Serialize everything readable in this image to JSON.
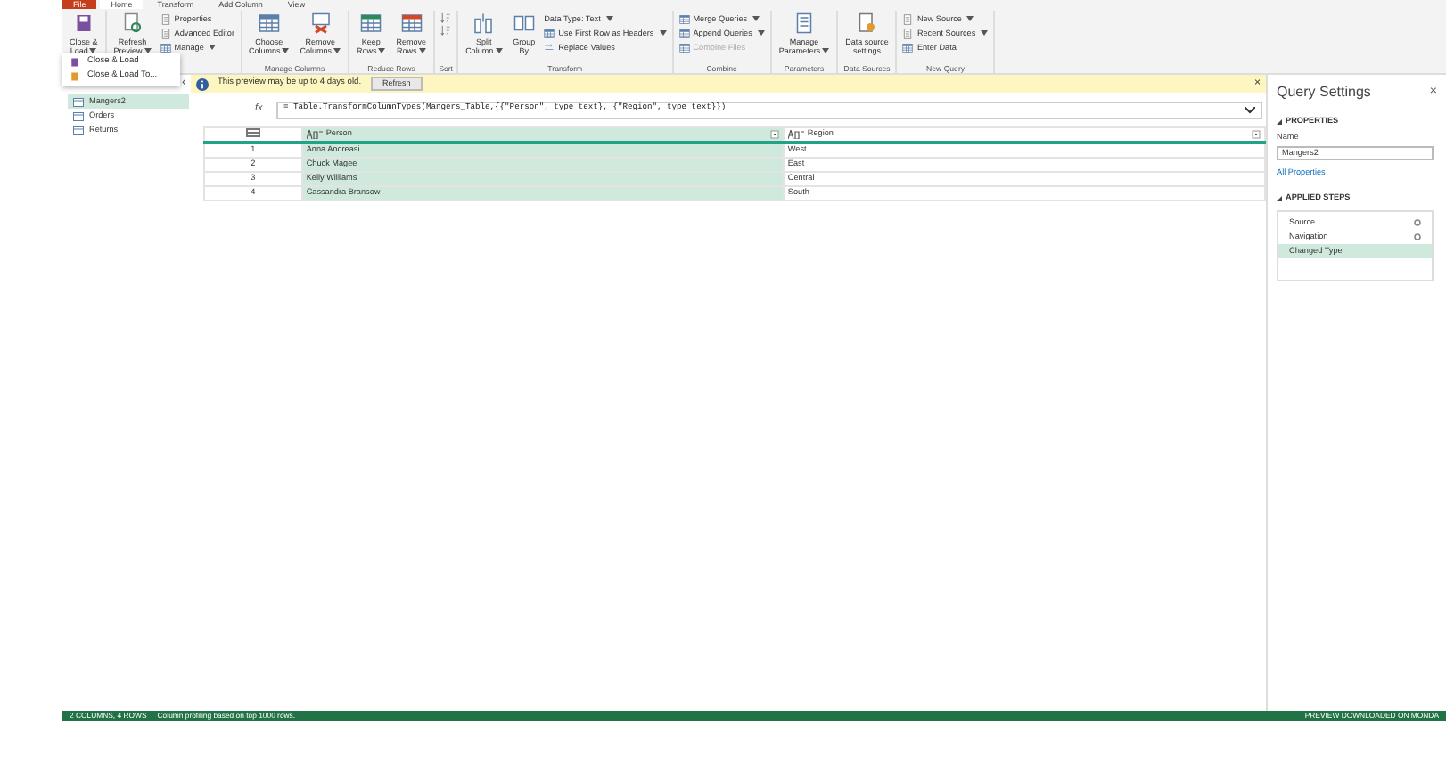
{
  "ribbon_tabs": [
    {
      "label": "File",
      "selected": false,
      "kind": "file"
    },
    {
      "label": "Home",
      "selected": true,
      "kind": "tab"
    },
    {
      "label": "Transform",
      "selected": false,
      "kind": "tab"
    },
    {
      "label": "Add Column",
      "selected": false,
      "kind": "tab"
    },
    {
      "label": "View",
      "selected": false,
      "kind": "tab"
    }
  ],
  "ribbon_groups": [
    {
      "items": [
        {
          "kind": "large",
          "lines": [
            "Close &",
            "Load"
          ],
          "dropdown": true
        }
      ]
    },
    {
      "items": [
        {
          "kind": "large",
          "lines": [
            "Refresh",
            "Preview"
          ],
          "dropdown": true
        },
        {
          "kind": "stack",
          "entries": [
            {
              "label": "Properties",
              "dropdown": false,
              "disabled": false
            },
            {
              "label": "Advanced Editor",
              "dropdown": false,
              "disabled": false
            },
            {
              "label": "Manage",
              "dropdown": true,
              "disabled": false
            }
          ]
        }
      ]
    },
    {
      "label": "Manage Columns",
      "items": [
        {
          "kind": "large",
          "lines": [
            "Choose",
            "Columns"
          ],
          "dropdown": true
        },
        {
          "kind": "large",
          "lines": [
            "Remove",
            "Columns"
          ],
          "dropdown": true
        }
      ]
    },
    {
      "label": "Reduce Rows",
      "items": [
        {
          "kind": "large",
          "lines": [
            "Keep",
            "Rows"
          ],
          "dropdown": true
        },
        {
          "kind": "large",
          "lines": [
            "Remove",
            "Rows"
          ],
          "dropdown": true
        }
      ]
    },
    {
      "label": "Sort",
      "items": [
        {
          "kind": "sort"
        }
      ]
    },
    {
      "label": "Transform",
      "items": [
        {
          "kind": "large",
          "lines": [
            "Split",
            "Column"
          ],
          "dropdown": true
        },
        {
          "kind": "large",
          "lines": [
            "Group",
            "By"
          ],
          "dropdown": false
        },
        {
          "kind": "stack",
          "entries": [
            {
              "label": "Data Type: Text",
              "dropdown": true,
              "disabled": false
            },
            {
              "label": "Use First Row as Headers",
              "dropdown": true,
              "disabled": false
            },
            {
              "label": "Replace Values",
              "dropdown": false,
              "disabled": false
            }
          ]
        }
      ]
    },
    {
      "label": "Combine",
      "items": [
        {
          "kind": "stack",
          "entries": [
            {
              "label": "Merge Queries",
              "dropdown": true,
              "disabled": false
            },
            {
              "label": "Append Queries",
              "dropdown": true,
              "disabled": false
            },
            {
              "label": "Combine Files",
              "dropdown": false,
              "disabled": true
            }
          ]
        }
      ]
    },
    {
      "label": "Parameters",
      "items": [
        {
          "kind": "large",
          "lines": [
            "Manage",
            "Parameters"
          ],
          "dropdown": true
        }
      ]
    },
    {
      "label": "Data Sources",
      "items": [
        {
          "kind": "large",
          "lines": [
            "Data source",
            "settings"
          ],
          "dropdown": false
        }
      ]
    },
    {
      "label": "New Query",
      "items": [
        {
          "kind": "stack",
          "entries": [
            {
              "label": "New Source",
              "dropdown": true,
              "disabled": false
            },
            {
              "label": "Recent Sources",
              "dropdown": true,
              "disabled": false
            },
            {
              "label": "Enter Data",
              "dropdown": false,
              "disabled": false
            }
          ]
        }
      ]
    }
  ],
  "close_load_menu": [
    {
      "label": "Close & Load"
    },
    {
      "label": "Close & Load To..."
    }
  ],
  "queries_collapse": "‹",
  "queries": [
    {
      "name": "Mangers2",
      "selected": true
    },
    {
      "name": "Orders",
      "selected": false
    },
    {
      "name": "Returns",
      "selected": false
    }
  ],
  "notice": {
    "text": "This preview may be up to 4 days old.",
    "button": "Refresh",
    "close": "×"
  },
  "formula": {
    "fx": "fx",
    "text": "= Table.TransformColumnTypes(Mangers_Table,{{\"Person\", type text}, {\"Region\", type text}})"
  },
  "table": {
    "columns": [
      {
        "label": "Person",
        "selected": true
      },
      {
        "label": "Region",
        "selected": false
      }
    ],
    "rows": [
      {
        "index": "1",
        "cells": [
          "Anna Andreasi",
          "West"
        ]
      },
      {
        "index": "2",
        "cells": [
          "Chuck Magee",
          "East"
        ]
      },
      {
        "index": "3",
        "cells": [
          "Kelly Williams",
          "Central"
        ]
      },
      {
        "index": "4",
        "cells": [
          "Cassandra Bransow",
          "South"
        ]
      }
    ]
  },
  "query_settings": {
    "title": "Query Settings",
    "close": "×",
    "properties_heading": "PROPERTIES",
    "name_label": "Name",
    "name_value": "Mangers2",
    "all_properties": "All Properties",
    "steps_heading": "APPLIED STEPS",
    "steps": [
      {
        "label": "Source",
        "gear": true,
        "selected": false
      },
      {
        "label": "Navigation",
        "gear": true,
        "selected": false
      },
      {
        "label": "Changed Type",
        "gear": false,
        "selected": true
      }
    ]
  },
  "status_bar": {
    "left": [
      "2 COLUMNS, 4 ROWS",
      "Column profiling based on top 1000 rows."
    ],
    "right": "PREVIEW DOWNLOADED ON MONDA"
  }
}
